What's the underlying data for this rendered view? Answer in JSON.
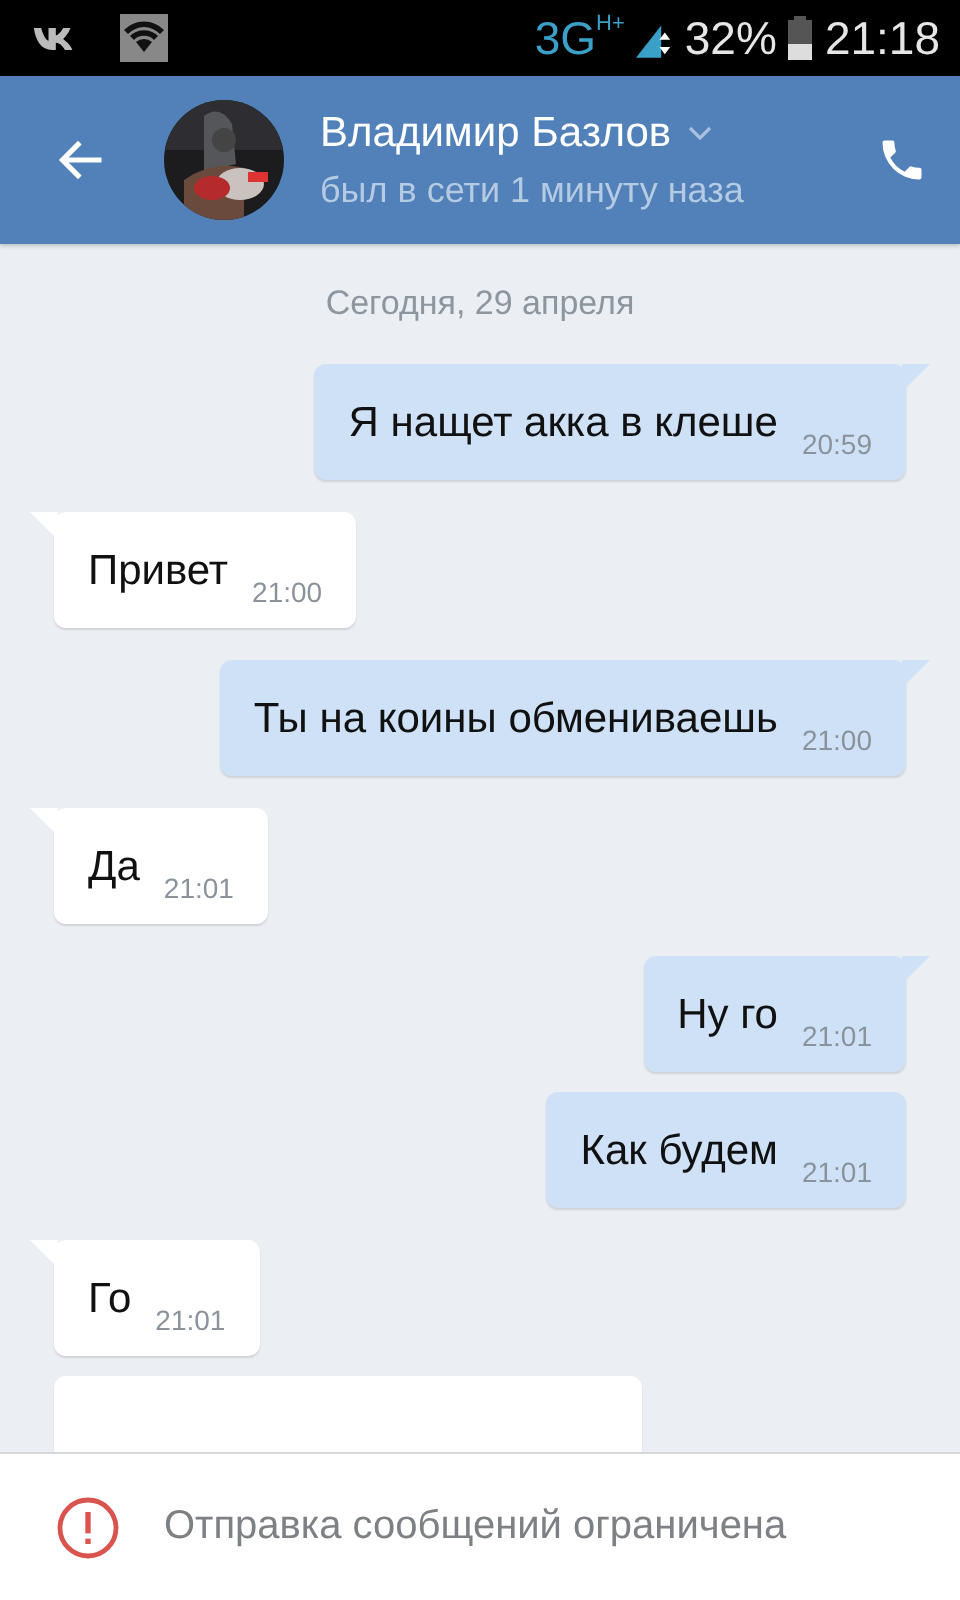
{
  "status_bar": {
    "network": "3G",
    "network_sub": "H+",
    "battery": "32%",
    "time": "21:18"
  },
  "header": {
    "name": "Владимир Базлов",
    "status": "был в сети 1 минуту наза"
  },
  "date": "Сегодня, 29 апреля",
  "messages": [
    {
      "kind": "outgoing",
      "tail": true,
      "text": "Я нащет акка в клеше",
      "time": "20:59"
    },
    {
      "kind": "incoming",
      "tail": true,
      "text": "Привет",
      "time": "21:00"
    },
    {
      "kind": "outgoing",
      "tail": true,
      "text": "Ты на коины обмениваешь",
      "time": "21:00"
    },
    {
      "kind": "incoming",
      "tail": true,
      "text": "Да",
      "time": "21:01"
    },
    {
      "kind": "outgoing",
      "tail": true,
      "text": "Ну го",
      "time": "21:01"
    },
    {
      "kind": "outgoing",
      "tail": false,
      "text": "Как будем",
      "time": "21:01"
    },
    {
      "kind": "incoming",
      "tail": true,
      "text": "Го",
      "time": "21:01"
    },
    {
      "kind": "incoming",
      "tail": false
    }
  ],
  "notice": "Отправка сообщений ограничена"
}
